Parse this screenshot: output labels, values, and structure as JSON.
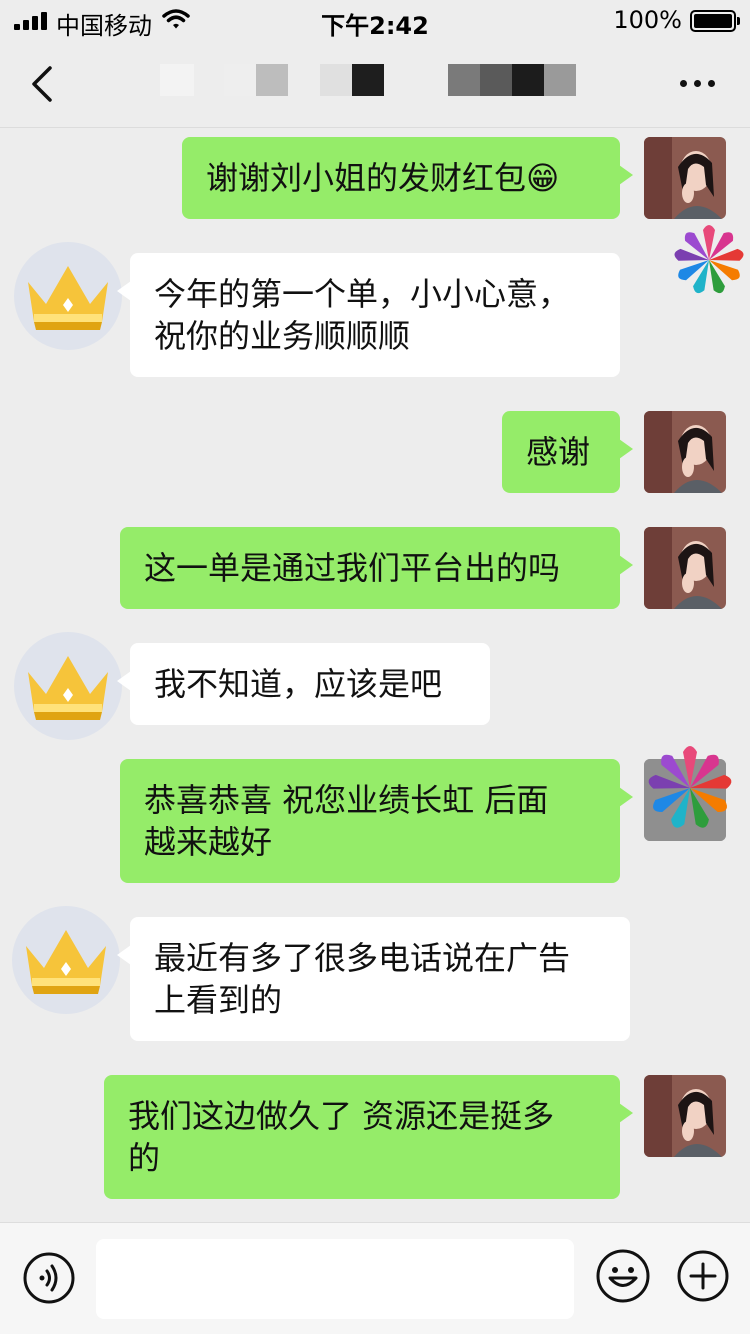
{
  "status_bar": {
    "carrier": "中国移动",
    "time": "下午2:42",
    "battery_percent": "100%",
    "battery_level": 1.0,
    "icons": [
      "signal-icon",
      "wifi-icon",
      "battery-icon"
    ]
  },
  "nav_bar": {
    "icons": [
      "back-icon",
      "more-icon"
    ]
  },
  "messages": [
    {
      "side": "right",
      "text_lines": [
        "谢谢刘小姐的发财红包😁"
      ]
    },
    {
      "side": "left",
      "text_lines": [
        "今年的第一个单，小小心意，",
        "祝你的业务顺顺顺"
      ]
    },
    {
      "side": "right",
      "text_lines": [
        "感谢"
      ]
    },
    {
      "side": "right",
      "text_lines": [
        "这一单是通过我们平台出的吗"
      ]
    },
    {
      "side": "left",
      "text_lines": [
        "我不知道，应该是吧"
      ]
    },
    {
      "side": "right",
      "text_lines": [
        "恭喜恭喜  祝您业绩长虹  后面",
        "越来越好"
      ]
    },
    {
      "side": "left",
      "text_lines": [
        "最近有多了很多电话说在广告",
        "上看到的"
      ]
    },
    {
      "side": "right",
      "text_lines": [
        "我们这边做久了  资源还是挺多",
        "的"
      ]
    }
  ],
  "input_bar": {
    "input_value": "",
    "icons": [
      "voice-icon",
      "emoji-icon",
      "plus-icon"
    ]
  },
  "colors": {
    "background": "#ededed",
    "outgoing_bubble": "#95ec69",
    "incoming_bubble": "#ffffff",
    "crown_gold": "#f5c518"
  }
}
